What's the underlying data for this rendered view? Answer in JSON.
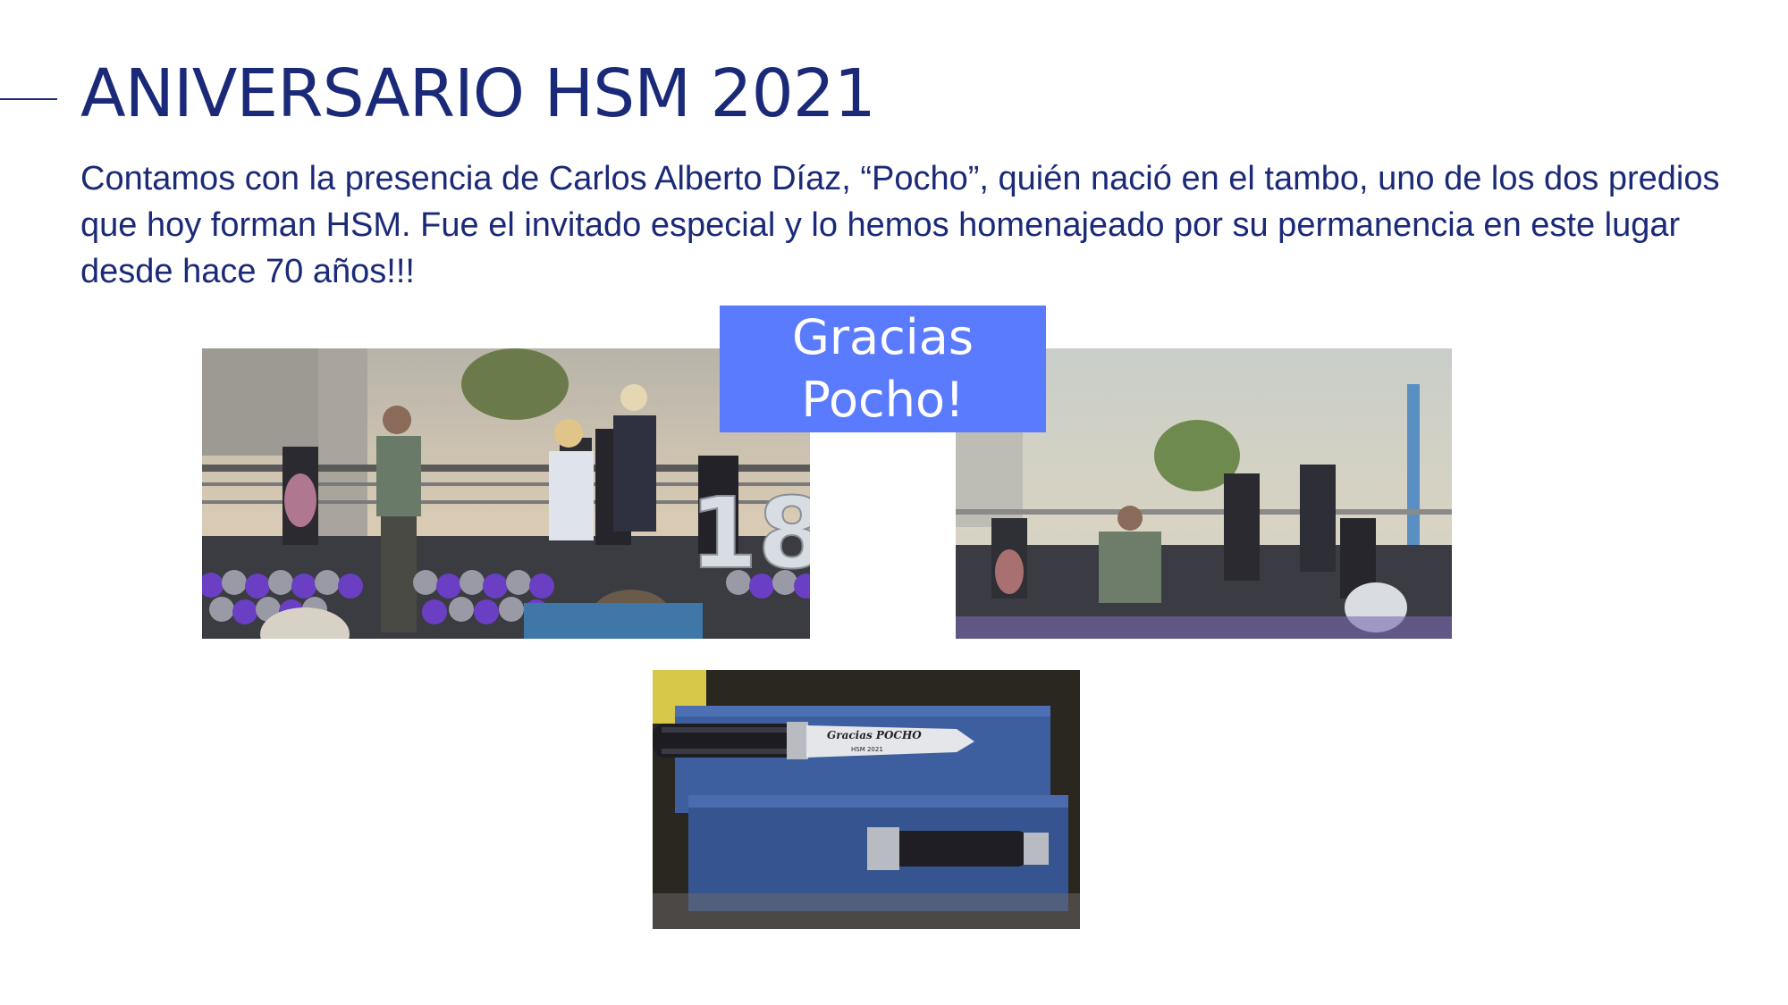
{
  "slide": {
    "title": "ANIVERSARIO HSM 2021",
    "body": "Contamos con la presencia de Carlos Alberto Díaz, “Pocho”, quién nació en el tambo, uno de los dos predios que hoy forman HSM. Fue el invitado especial y lo hemos homenajeado por su permanencia en este lugar desde hace 70 años!!!",
    "callout": {
      "line1": "Gracias",
      "line2": "Pocho!"
    },
    "knife_engraving": {
      "line1": "Gracias POCHO",
      "line2": "HSM 2021"
    },
    "balloon_number": "18"
  },
  "colors": {
    "title": "#1b2a78",
    "callout_bg": "#5b7bff",
    "callout_text": "#ffffff",
    "balloons_purple": "#6a3fc4",
    "balloons_grey": "#9a9aa6"
  }
}
